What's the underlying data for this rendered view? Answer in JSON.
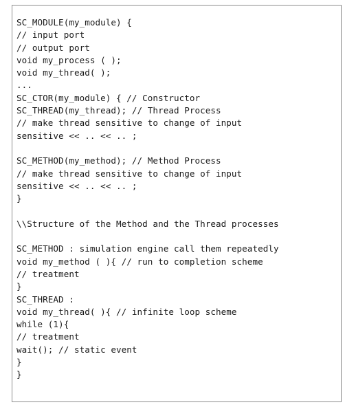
{
  "figure": {
    "kind": "code-listing",
    "language": "SystemC / C++",
    "border_color": "#8a8a8a",
    "background_color": "#ffffff",
    "text_color": "#1a1a1a"
  },
  "code": {
    "lines": [
      "SC_MODULE(my_module) {",
      "// input port",
      "// output port",
      "void my_process ( );",
      "void my_thread( );",
      "...",
      "SC_CTOR(my_module) { // Constructor",
      "SC_THREAD(my_thread); // Thread Process",
      "// make thread sensitive to change of input",
      "sensitive << .. << .. ;",
      "",
      "SC_METHOD(my_method); // Method Process",
      "// make thread sensitive to change of input",
      "sensitive << .. << .. ;",
      "}",
      "",
      "\\\\Structure of the Method and the Thread processes",
      "",
      "SC_METHOD : simulation engine call them repeatedly",
      "void my_method ( ){ // run to completion scheme",
      "// treatment",
      "}",
      "SC_THREAD :",
      "void my_thread( ){ // infinite loop scheme",
      "while (1){",
      "// treatment",
      "wait(); // static event",
      "}",
      "}"
    ]
  }
}
